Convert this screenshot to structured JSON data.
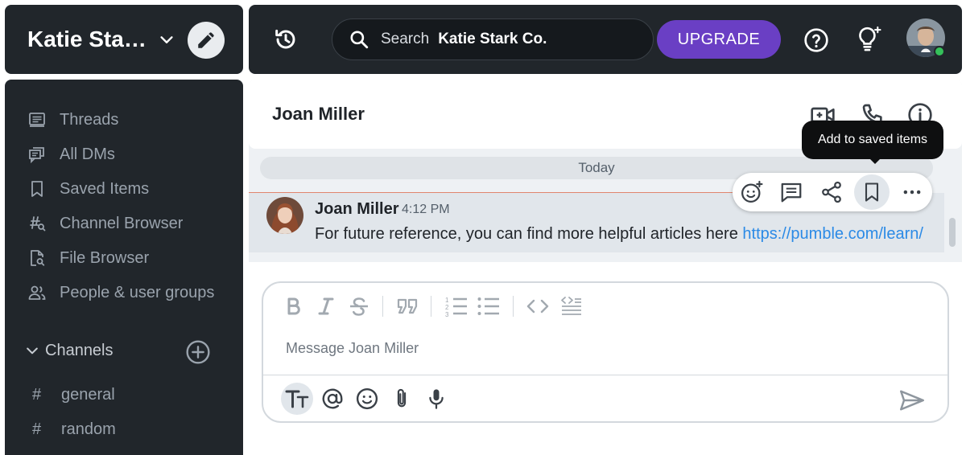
{
  "workspace": {
    "name": "Katie Stark Co."
  },
  "topbar": {
    "search_label": "Search",
    "search_scope": "Katie Stark Co.",
    "upgrade_label": "UPGRADE"
  },
  "sidebar": {
    "items": [
      {
        "label": "Threads",
        "icon": "threads-icon"
      },
      {
        "label": "All DMs",
        "icon": "dms-icon"
      },
      {
        "label": "Saved Items",
        "icon": "bookmark-icon"
      },
      {
        "label": "Channel Browser",
        "icon": "channel-browser-icon"
      },
      {
        "label": "File Browser",
        "icon": "file-search-icon"
      },
      {
        "label": "People & user groups",
        "icon": "people-icon"
      }
    ],
    "channels_label": "Channels",
    "channels": [
      {
        "name": "general"
      },
      {
        "name": "random"
      }
    ]
  },
  "chat": {
    "title": "Joan Miller",
    "date_divider": "Today",
    "tooltip": "Add to saved items",
    "message": {
      "author": "Joan Miller",
      "time": "4:12 PM",
      "text": "For future reference, you can find more helpful articles here ",
      "link": "https://pumble.com/learn/"
    },
    "composer_placeholder": "Message Joan Miller"
  },
  "colors": {
    "dark_panel": "#21262b",
    "accent_purple": "#6a3fc4",
    "link_blue": "#2b8ae6",
    "online_green": "#35c05a",
    "unread_line": "#e0856e"
  }
}
